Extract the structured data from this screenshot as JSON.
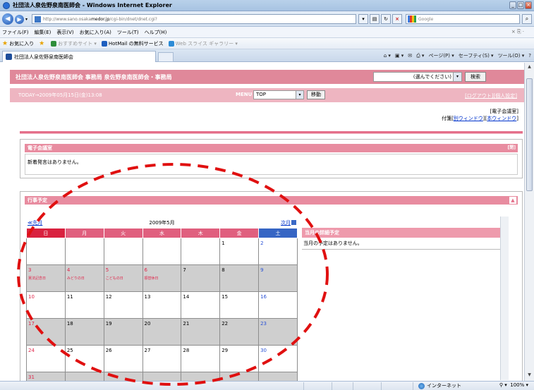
{
  "window": {
    "title": "社団法人泉佐野泉南医師会 - Windows Internet Explorer"
  },
  "address": {
    "url_prefix": "http://www.sano.osaka",
    "url_domain": "medor.jp",
    "url_rest": "/cgi-bin/dnet/dnet.cgi?"
  },
  "search": {
    "placeholder": "Google"
  },
  "menubar": {
    "items": [
      "ファイル(F)",
      "編集(E)",
      "表示(V)",
      "お気に入り(A)",
      "ツール(T)",
      "ヘルプ(H)"
    ]
  },
  "favorites": {
    "label": "お気に入り",
    "items": [
      "おすすめサイト ▾",
      "HotMail の無料サービス",
      "Web スライス ギャラリー ▾"
    ]
  },
  "tab": {
    "title": "社団法人泉佐野泉南医師会"
  },
  "commandbar": {
    "items": [
      "ページ(P) ▾",
      "セーフティ(S) ▾",
      "ツール(O) ▾"
    ]
  },
  "site": {
    "header": "社団法人泉佐野泉南医師会 事務局 泉佐野泉南医師会・事務局",
    "select_value": "(選んでください)",
    "go_label": "検索",
    "today": "TODAY→2009年05月15日(金)13:08",
    "menu_label": "MENU",
    "menu_value": "TOP",
    "menu_go": "移動",
    "logout": "[ログアウト]",
    "personal": "[個人設定]",
    "elec_label": "[電子会議室]",
    "fusen_prefix": "付箋",
    "fusen_open1": "[",
    "fusen_link1": "別ウィンドウ",
    "fusen_mid": "][",
    "fusen_link2": "本ウィンドウ",
    "fusen_close": "]"
  },
  "panel_meeting": {
    "title": "電子会議室",
    "close_label": "[閉]",
    "body": "新着発言はありません。"
  },
  "panel_schedule": {
    "title": "行事予定",
    "collapse": "▲"
  },
  "calendar": {
    "prev": "≪先月",
    "month": "2009年5月",
    "next": "次月",
    "weekdays": [
      "日",
      "月",
      "火",
      "水",
      "木",
      "金",
      "土"
    ],
    "weeks": [
      [
        {
          "d": ""
        },
        {
          "d": ""
        },
        {
          "d": ""
        },
        {
          "d": ""
        },
        {
          "d": ""
        },
        {
          "d": "1"
        },
        {
          "d": "2"
        }
      ],
      [
        {
          "d": "3",
          "h": "憲法記念日"
        },
        {
          "d": "4",
          "h": "みどりの日"
        },
        {
          "d": "5",
          "h": "こどもの日"
        },
        {
          "d": "6",
          "h": "振替休日"
        },
        {
          "d": "7"
        },
        {
          "d": "8"
        },
        {
          "d": "9"
        }
      ],
      [
        {
          "d": "10"
        },
        {
          "d": "11"
        },
        {
          "d": "12"
        },
        {
          "d": "13"
        },
        {
          "d": "14"
        },
        {
          "d": "15"
        },
        {
          "d": "16"
        }
      ],
      [
        {
          "d": "17"
        },
        {
          "d": "18"
        },
        {
          "d": "19"
        },
        {
          "d": "20"
        },
        {
          "d": "21"
        },
        {
          "d": "22"
        },
        {
          "d": "23"
        }
      ],
      [
        {
          "d": "24"
        },
        {
          "d": "25"
        },
        {
          "d": "26"
        },
        {
          "d": "27"
        },
        {
          "d": "28"
        },
        {
          "d": "29"
        },
        {
          "d": "30"
        }
      ],
      [
        {
          "d": "31"
        },
        {
          "d": ""
        },
        {
          "d": ""
        },
        {
          "d": ""
        },
        {
          "d": ""
        },
        {
          "d": ""
        },
        {
          "d": ""
        }
      ]
    ]
  },
  "month_detail": {
    "title": "当月の詳細予定",
    "body": "当月の予定はありません。"
  },
  "status": {
    "zone": "インターネット",
    "zoom": "100%"
  },
  "colors": {
    "annotation": "#e01010",
    "header_pink": "#e0889a",
    "accent": "#e46f8a"
  }
}
